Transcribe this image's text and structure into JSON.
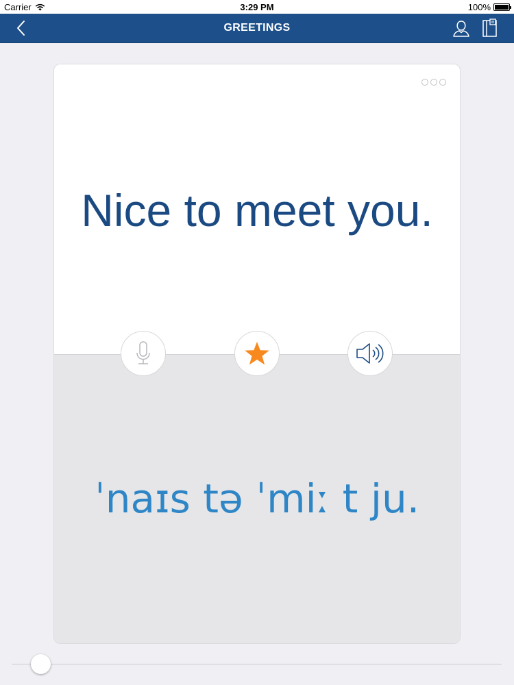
{
  "status_bar": {
    "carrier": "Carrier",
    "time": "3:29 PM",
    "battery": "100%",
    "battery_level": 1.0
  },
  "nav": {
    "title": "GREETINGS",
    "back_icon": "chevron-left-icon",
    "user_icon": "user-icon",
    "book_icon": "book-icon"
  },
  "card": {
    "phrase": "Nice to meet you.",
    "phonetic": "ˈnaɪs tə ˈmiː t ju.",
    "more_icon": "more-dots-icon"
  },
  "actions": {
    "mic_icon": "microphone-icon",
    "star_icon": "star-icon",
    "speaker_icon": "speaker-icon"
  },
  "slider": {
    "value": 0.03
  },
  "colors": {
    "nav_background": "#1d4f8a",
    "phrase_text": "#1b4a82",
    "phonetic_text": "#2f86c6",
    "star": "#f7891f",
    "page_background": "#efeff4",
    "card_bottom": "#e6e6e8"
  }
}
